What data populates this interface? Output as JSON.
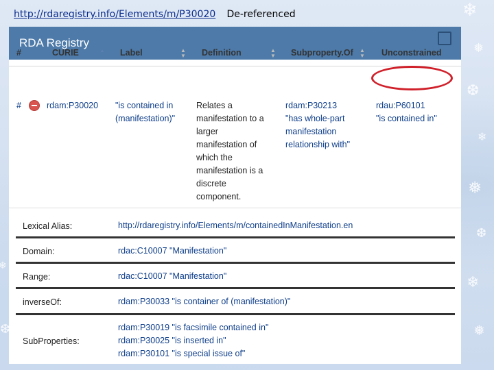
{
  "slide": {
    "url": "http://rdaregistry.info/Elements/m/P30020",
    "note": "De-referenced"
  },
  "panel": {
    "title": "RDA Registry"
  },
  "table": {
    "headers": [
      "#",
      "CURIE",
      "Label",
      "Definition",
      "Subproperty.Of",
      "Unconstrained"
    ],
    "row": {
      "hash": "#",
      "curie": "rdam:P30020",
      "label": [
        "\"is contained in",
        "(manifestation)\""
      ],
      "definition": [
        "Relates a",
        "manifestation to a",
        "larger",
        "manifestation of",
        "which the",
        "manifestation is a",
        "discrete",
        "component."
      ],
      "subproperty_of": [
        "rdam:P30213",
        "\"has whole-part",
        "manifestation",
        "relationship with\""
      ],
      "unconstrained": [
        "rdau:P60101",
        "\"is contained in\""
      ]
    }
  },
  "details": {
    "lexical_alias": {
      "label": "Lexical Alias:",
      "value": "http://rdaregistry.info/Elements/m/containedInManifestation.en"
    },
    "domain": {
      "label": "Domain:",
      "value": "rdac:C10007  \"Manifestation\""
    },
    "range": {
      "label": "Range:",
      "value": "rdac:C10007  \"Manifestation\""
    },
    "inverse_of": {
      "label": "inverseOf:",
      "value": "rdam:P30033  \"is container of (manifestation)\""
    },
    "sub_properties": {
      "label": "SubProperties:",
      "values": [
        "rdam:P30019  \"is facsimile contained in\"",
        "rdam:P30025  \"is inserted in\"",
        "rdam:P30101  \"is special issue of\""
      ]
    }
  },
  "colors": {
    "header_bg": "#4d7aa9",
    "link": "#0e3e8a",
    "highlight_circle": "#d0202a"
  }
}
